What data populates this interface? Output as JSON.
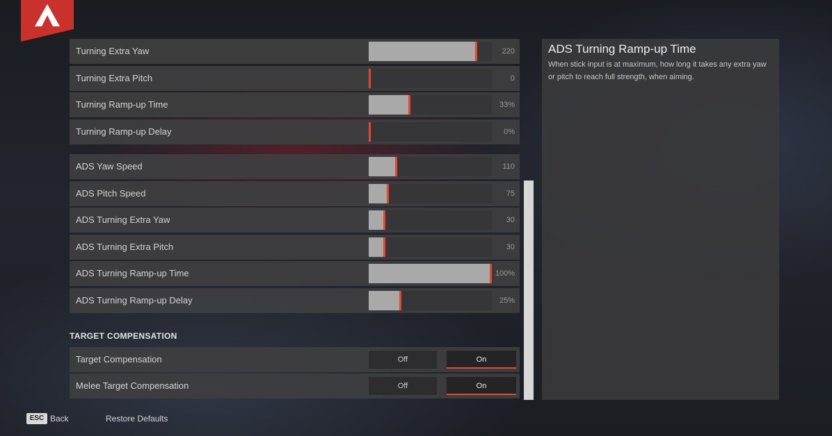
{
  "settings": {
    "rows_top": [
      {
        "label": "Turning Extra Yaw",
        "value": "220",
        "fraction": 0.88
      },
      {
        "label": "Turning Extra Pitch",
        "value": "0",
        "fraction": 0.0
      },
      {
        "label": "Turning Ramp-up Time",
        "value": "33%",
        "fraction": 0.33
      },
      {
        "label": "Turning Ramp-up Delay",
        "value": "0%",
        "fraction": 0.0
      }
    ],
    "rows_ads": [
      {
        "label": "ADS Yaw Speed",
        "value": "110",
        "fraction": 0.22
      },
      {
        "label": "ADS Pitch Speed",
        "value": "75",
        "fraction": 0.15
      },
      {
        "label": "ADS Turning Extra Yaw",
        "value": "30",
        "fraction": 0.12
      },
      {
        "label": "ADS Turning Extra Pitch",
        "value": "30",
        "fraction": 0.12
      },
      {
        "label": "ADS Turning Ramp-up Time",
        "value": "100%",
        "fraction": 1.0
      },
      {
        "label": "ADS Turning Ramp-up Delay",
        "value": "25%",
        "fraction": 0.25
      }
    ],
    "section_title": "TARGET COMPENSATION",
    "toggles": [
      {
        "label": "Target Compensation",
        "off_label": "Off",
        "on_label": "On",
        "selected": "on"
      },
      {
        "label": "Melee Target Compensation",
        "off_label": "Off",
        "on_label": "On",
        "selected": "on"
      }
    ]
  },
  "info": {
    "title": "ADS Turning Ramp-up Time",
    "description": "When stick input is at maximum, how long it takes any extra yaw or pitch to reach full strength, when aiming."
  },
  "footer": {
    "esc_key": "ESC",
    "back_label": "Back",
    "restore_label": "Restore Defaults"
  },
  "colors": {
    "accent": "#e6472f",
    "logo_red": "#c8312c"
  },
  "icons": {
    "logo": "apex-logo-icon"
  }
}
